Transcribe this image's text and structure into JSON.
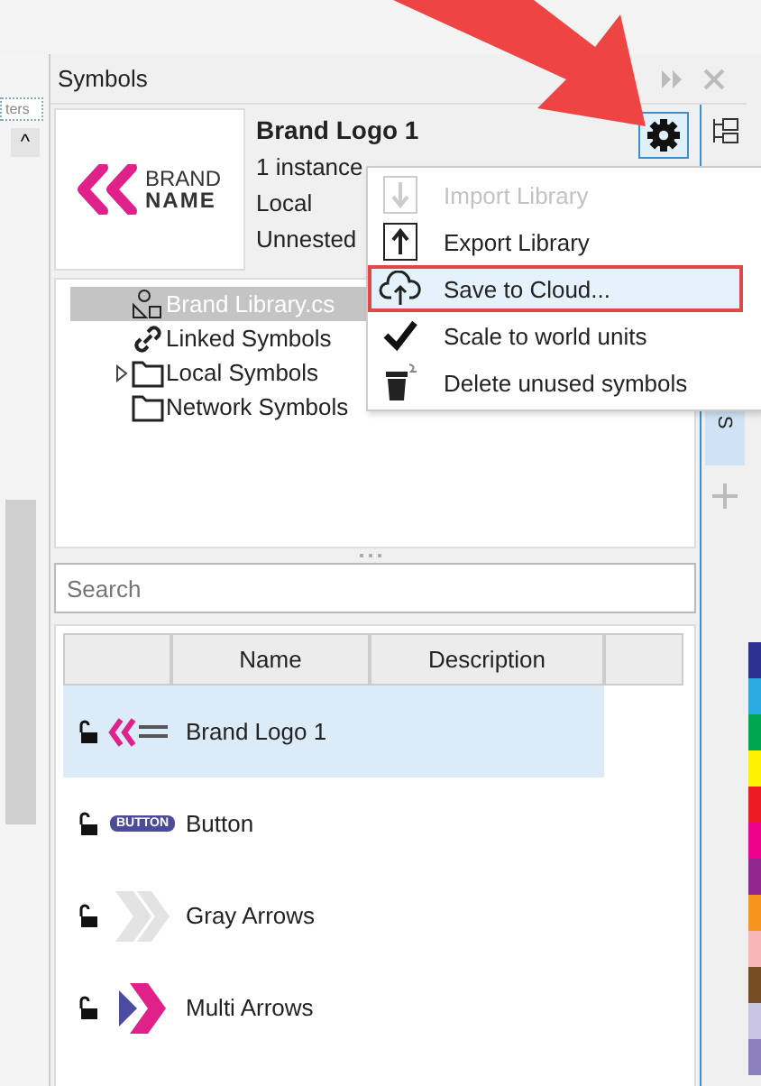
{
  "side_strip": {
    "clipped_label": "ters",
    "scroll_button": "^"
  },
  "panel": {
    "title": "Symbols"
  },
  "preview": {
    "logo_lines": [
      "BRAND",
      "NAME"
    ],
    "name": "Brand Logo 1",
    "details": [
      "1 instance",
      "Local",
      "Unnested"
    ]
  },
  "tree": [
    {
      "label": "Brand Library.cs",
      "kind": "library",
      "selected": true
    },
    {
      "label": "Linked Symbols",
      "kind": "link",
      "selected": false
    },
    {
      "label": "Local Symbols",
      "kind": "folder",
      "selected": false,
      "expanded": false
    },
    {
      "label": "Network Symbols",
      "kind": "folder",
      "selected": false
    }
  ],
  "menu": [
    {
      "label": "Import Library",
      "kind": "import",
      "disabled": true,
      "selected": false
    },
    {
      "label": "Export Library",
      "kind": "export",
      "disabled": false,
      "selected": false
    },
    {
      "label": "Save to Cloud...",
      "kind": "cloud",
      "disabled": false,
      "selected": true
    },
    {
      "label": "Scale to world units",
      "kind": "check",
      "disabled": false,
      "selected": false
    },
    {
      "label": "Delete unused symbols",
      "kind": "trash",
      "disabled": false,
      "selected": false
    }
  ],
  "search": {
    "placeholder": "Search"
  },
  "table": {
    "columns": [
      {
        "label": "Name"
      },
      {
        "label": "Description"
      }
    ],
    "rows": [
      {
        "name": "Brand Logo 1",
        "kind": "logo",
        "selected": true
      },
      {
        "name": "Button",
        "kind": "button",
        "thumb_text": "BUTTON",
        "selected": false
      },
      {
        "name": "Gray Arrows",
        "kind": "gray-arrows",
        "selected": false
      },
      {
        "name": "Multi Arrows",
        "kind": "multi-arrows",
        "selected": false
      }
    ]
  },
  "side_tab": {
    "label": "S"
  },
  "palette": [
    {
      "color": "#2e3192"
    },
    {
      "color": "#29abe2"
    },
    {
      "color": "#00a651"
    },
    {
      "color": "#fff200"
    },
    {
      "color": "#ed1c24"
    },
    {
      "color": "#ec008c"
    },
    {
      "color": "#92278f"
    },
    {
      "color": "#f7941d"
    },
    {
      "color": "#f7b7b9"
    },
    {
      "color": "#754c24"
    },
    {
      "color": "#c8c3e0"
    },
    {
      "color": "#8c7fc0"
    }
  ]
}
